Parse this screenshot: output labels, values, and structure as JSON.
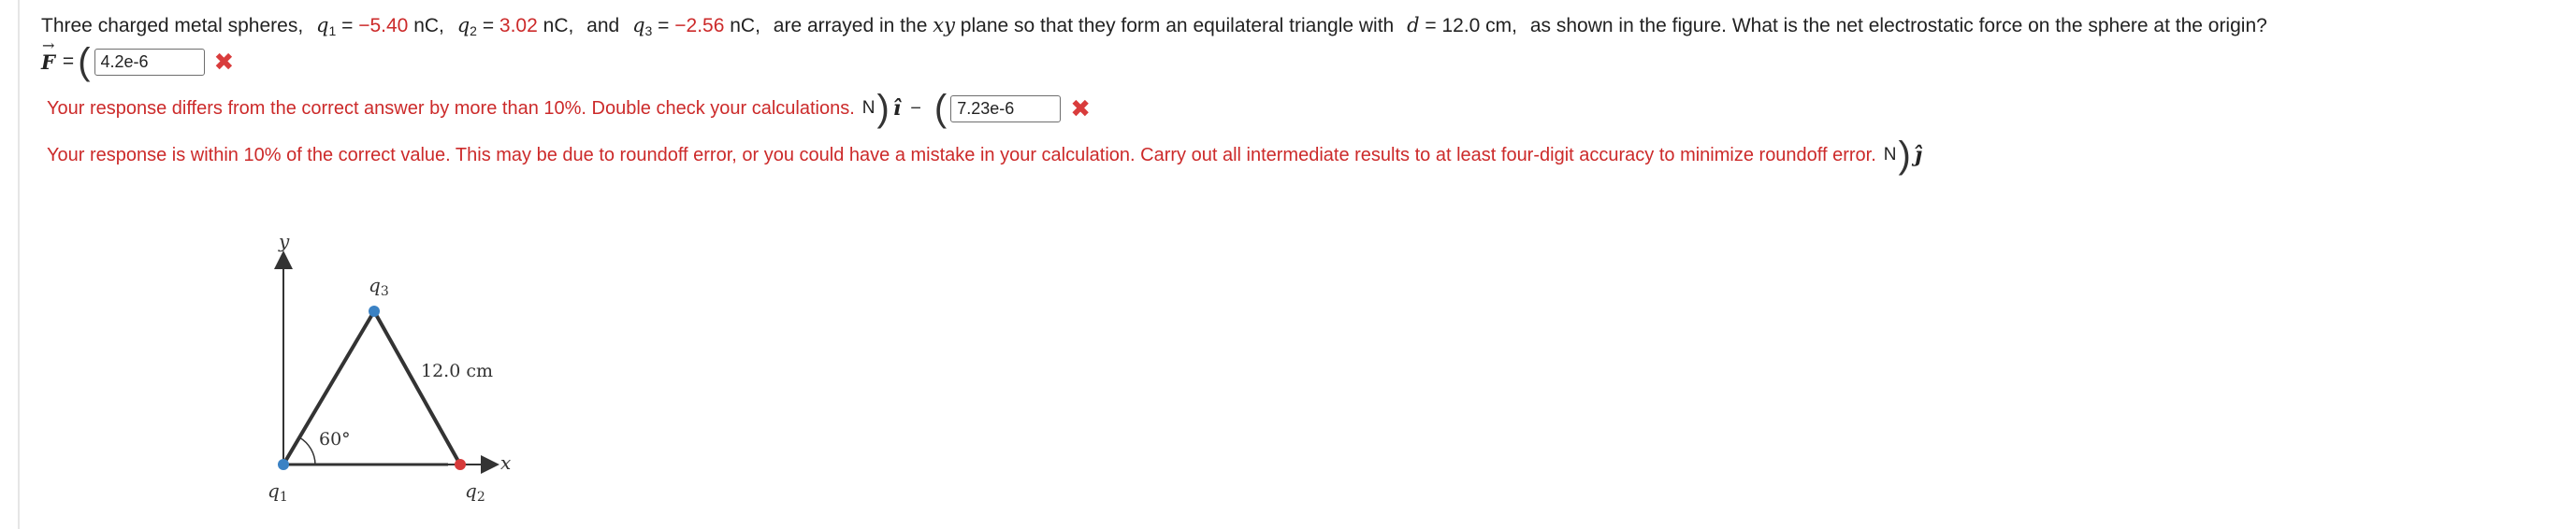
{
  "question": {
    "intro": "Three charged metal spheres,",
    "q1_var": "q",
    "q1_sub": "1",
    "eq": "=",
    "q1_value": "−5.40",
    "unit_nC": "nC,",
    "q2_var": "q",
    "q2_sub": "2",
    "q2_value": "3.02",
    "and_text": "and",
    "q3_var": "q",
    "q3_sub": "3",
    "q3_value": "−2.56",
    "text_mid": "are arrayed in the",
    "plane_var": "xy",
    "text_mid2": "plane so that they form an equilateral triangle with",
    "d_var": "d",
    "d_value": "= 12.0 cm,",
    "text_end": "as shown in the figure. What is the net electrostatic force on the sphere at the origin?"
  },
  "answer": {
    "force_symbol": "F",
    "force_arrow": "→",
    "equals": "=",
    "open_paren": "(",
    "close_paren": ")",
    "minus": "−",
    "x_component_value": "4.2e-6",
    "y_component_value": "7.23e-6",
    "unit": "N",
    "i_hat": "î",
    "j_hat": "ĵ",
    "incorrect_mark": "✖"
  },
  "feedback": {
    "x_message": "Your response differs from the correct answer by more than 10%. Double check your calculations.",
    "y_message": "Your response is within 10% of the correct value. This may be due to roundoff error, or you could have a mistake in your calculation. Carry out all intermediate results to at least four-digit accuracy to minimize roundoff error."
  },
  "figure": {
    "y_axis_label": "y",
    "x_axis_label": "x",
    "q1_label": "q",
    "q1_sub": "1",
    "q2_label": "q",
    "q2_sub": "2",
    "q3_label": "q",
    "q3_sub": "3",
    "side_label": "12.0 cm",
    "angle_label": "60°",
    "colors": {
      "q1_dot": "#3b82c4",
      "q2_dot": "#d63a3a",
      "q3_dot": "#3b82c4",
      "lines": "#333333"
    }
  },
  "colors": {
    "error_red": "#cc2a2a",
    "value_red": "#cc2a2a",
    "x_mark": "#d93c3c"
  }
}
